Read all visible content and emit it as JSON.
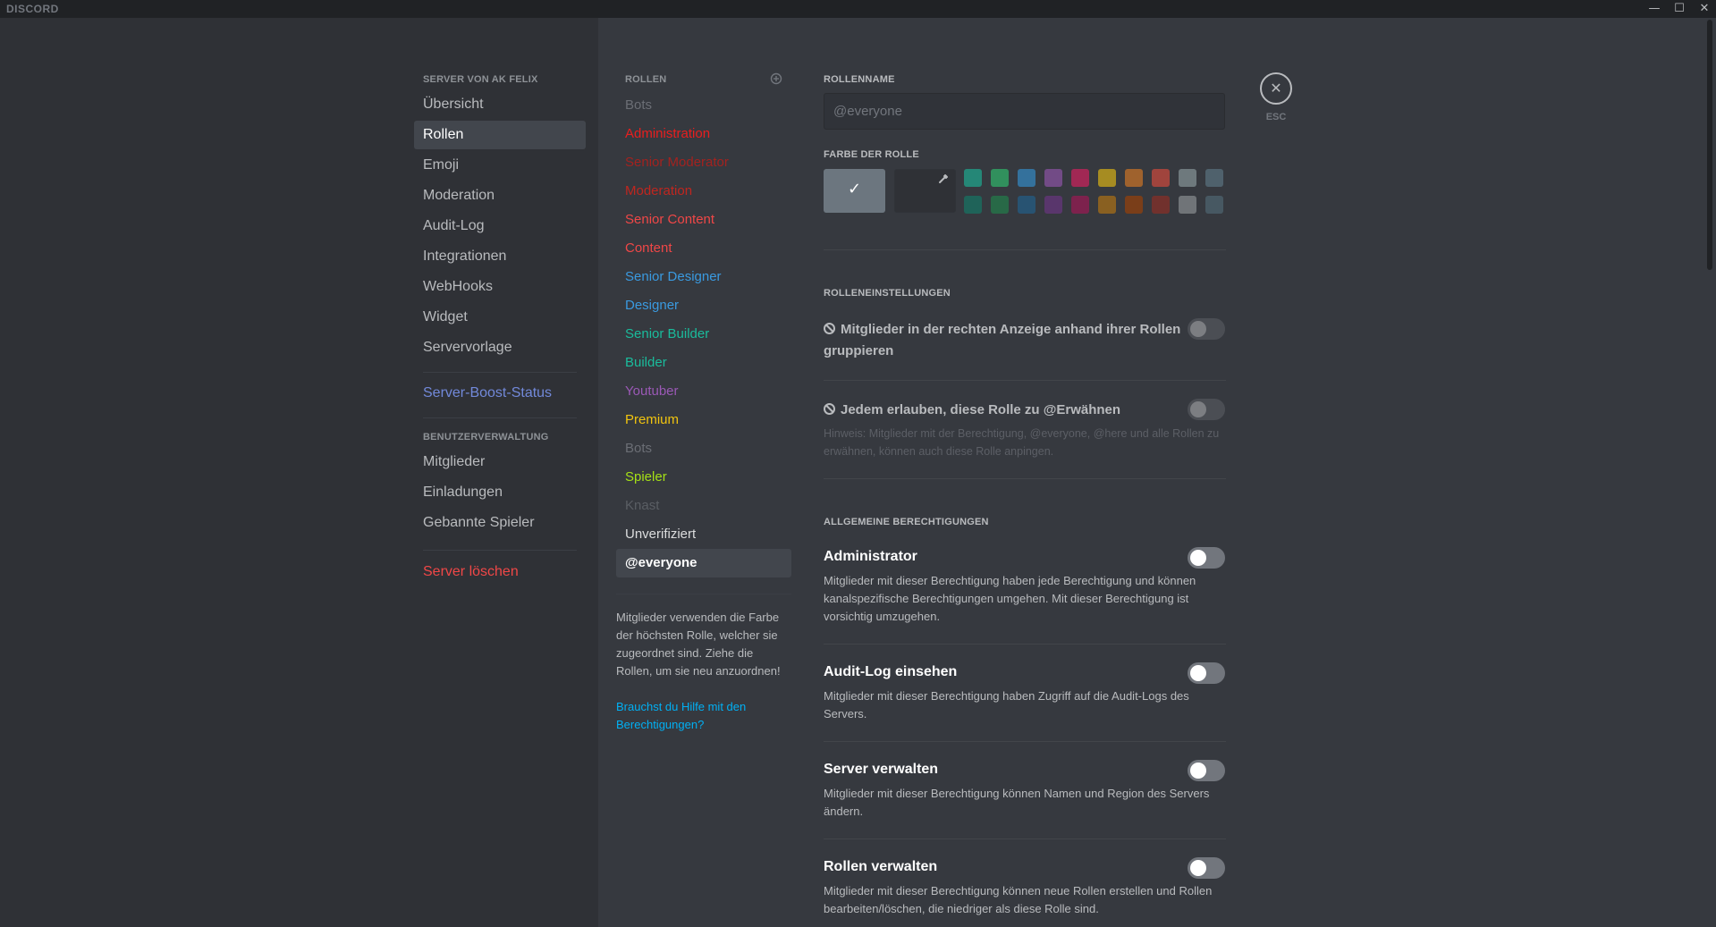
{
  "window": {
    "app_title": "DISCORD",
    "minimize_glyph": "—",
    "maximize_glyph": "☐",
    "close_glyph": "✕"
  },
  "sidebar": {
    "server_header": "SERVER VON AK FELIX",
    "items": [
      {
        "label": "Übersicht"
      },
      {
        "label": "Rollen",
        "selected": true
      },
      {
        "label": "Emoji"
      },
      {
        "label": "Moderation"
      },
      {
        "label": "Audit-Log"
      },
      {
        "label": "Integrationen"
      },
      {
        "label": "WebHooks"
      },
      {
        "label": "Widget"
      },
      {
        "label": "Servervorlage"
      }
    ],
    "boost_label": "Server-Boost-Status",
    "user_header": "BENUTZERVERWALTUNG",
    "user_items": [
      {
        "label": "Mitglieder"
      },
      {
        "label": "Einladungen"
      },
      {
        "label": "Gebannte Spieler"
      }
    ],
    "delete_label": "Server löschen"
  },
  "roles": {
    "header": "ROLLEN",
    "add_icon": "add-circle-icon",
    "list": [
      {
        "name": "Bots",
        "color": "#6b6e75"
      },
      {
        "name": "Administration",
        "color": "#e91e1e"
      },
      {
        "name": "Senior Moderator",
        "color": "#a3221f"
      },
      {
        "name": "Moderation",
        "color": "#c0261f"
      },
      {
        "name": "Senior Content",
        "color": "#f04747"
      },
      {
        "name": "Content",
        "color": "#f04747"
      },
      {
        "name": "Senior Designer",
        "color": "#3a9ae0"
      },
      {
        "name": "Designer",
        "color": "#3a9ae0"
      },
      {
        "name": "Senior Builder",
        "color": "#1abc9c"
      },
      {
        "name": "Builder",
        "color": "#1abc9c"
      },
      {
        "name": "Youtuber",
        "color": "#9b59b6"
      },
      {
        "name": "Premium",
        "color": "#f1c40f"
      },
      {
        "name": "Bots",
        "color": "#6b6e75"
      },
      {
        "name": "Spieler",
        "color": "#a5e016"
      },
      {
        "name": "Knast",
        "color": "#5a5e64"
      },
      {
        "name": "Unverifiziert",
        "color": "#dcddde"
      },
      {
        "name": "@everyone",
        "color": "#ffffff",
        "selected": true
      }
    ],
    "help_text": "Mitglieder verwenden die Farbe der höchsten Rolle, welcher sie zugeordnet sind. Ziehe die Rollen, um sie neu anzuordnen!",
    "help_link": "Brauchst du Hilfe mit den Berechtigungen?"
  },
  "editor": {
    "role_name_label": "ROLLENNAME",
    "role_name_value": "@everyone",
    "color_label": "FARBE DER ROLLE",
    "colors_row1": [
      "#1abc9c",
      "#2ecc71",
      "#3498db",
      "#9b59b6",
      "#e91e63",
      "#f1c40f",
      "#e67e22",
      "#e74c3c",
      "#95a5a6",
      "#607d8b"
    ],
    "colors_row2": [
      "#11806a",
      "#1f8b4c",
      "#206694",
      "#71368a",
      "#ad1457",
      "#c27c0e",
      "#a84300",
      "#992d22",
      "#979c9f",
      "#546e7a"
    ],
    "settings_header": "ROLLENEINSTELLUNGEN",
    "hoist_label": "Mitglieder in der rechten Anzeige anhand ihrer Rollen gruppieren",
    "mention_label": "Jedem erlauben, diese Rolle zu @Erwähnen",
    "mention_hint": "Hinweis: Mitglieder mit der Berechtigung, @everyone, @here und alle Rollen zu erwähnen, können auch diese Rolle anpingen.",
    "general_header": "ALLGEMEINE BERECHTIGUNGEN",
    "permissions": [
      {
        "title": "Administrator",
        "desc": "Mitglieder mit dieser Berechtigung haben jede Berechtigung und können kanalspezifische Berechtigungen umgehen. Mit dieser Berechtigung ist vorsichtig umzugehen.",
        "enabled": false
      },
      {
        "title": "Audit-Log einsehen",
        "desc": "Mitglieder mit dieser Berechtigung haben Zugriff auf die Audit-Logs des Servers.",
        "enabled": false
      },
      {
        "title": "Server verwalten",
        "desc": "Mitglieder mit dieser Berechtigung können Namen und Region des Servers ändern.",
        "enabled": false
      },
      {
        "title": "Rollen verwalten",
        "desc": "Mitglieder mit dieser Berechtigung können neue Rollen erstellen und Rollen bearbeiten/löschen, die niedriger als diese Rolle sind.",
        "enabled": false
      }
    ]
  },
  "close": {
    "glyph": "✕",
    "label": "ESC"
  }
}
